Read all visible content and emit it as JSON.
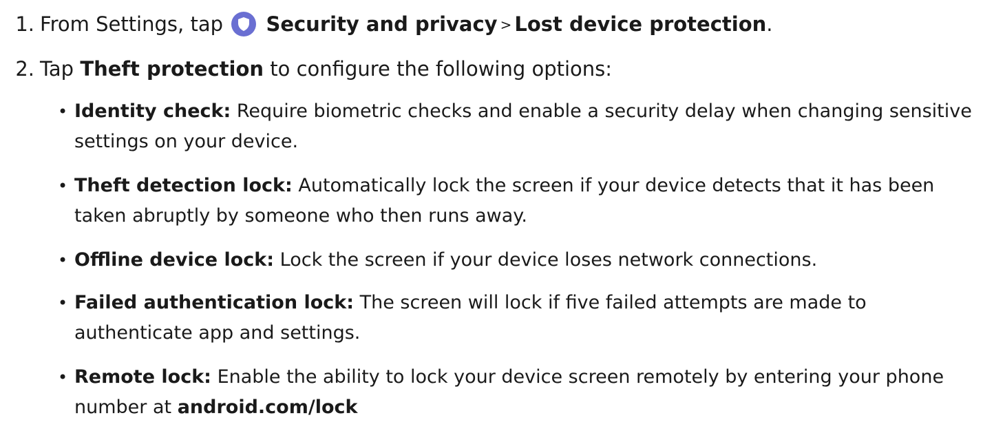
{
  "steps": [
    {
      "number": "1.",
      "prefix": "From Settings, tap",
      "icon": "shield-icon",
      "icon_color": "#6a6fd2",
      "bold1": "Security and privacy",
      "separator": ">",
      "bold2": "Lost device protection",
      "suffix": "."
    },
    {
      "number": "2.",
      "prefix": "Tap",
      "bold1": "Theft protection",
      "suffix": "to configure the following options:"
    }
  ],
  "options": [
    {
      "term": "Identity check:",
      "description": "Require biometric checks and enable a security delay when changing sensitive settings on your device."
    },
    {
      "term": "Theft detection lock:",
      "description": "Automatically lock the screen if your device detects that it has been taken abruptly by someone who then runs away."
    },
    {
      "term": "Offline device lock:",
      "description": "Lock the screen if your device loses network connections."
    },
    {
      "term": "Failed authentication lock:",
      "description": "The screen will lock if five failed attempts are made to authenticate app and settings."
    },
    {
      "term": "Remote lock:",
      "description": "Enable the ability to lock your device screen remotely by entering your phone number at",
      "link": "android.com/lock"
    }
  ]
}
